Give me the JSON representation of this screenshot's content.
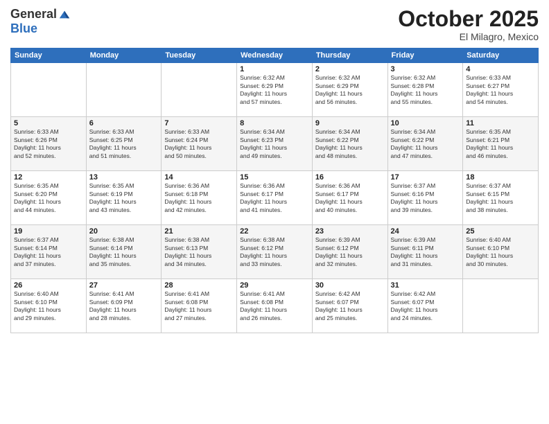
{
  "header": {
    "logo_line1": "General",
    "logo_line2": "Blue",
    "month": "October 2025",
    "location": "El Milagro, Mexico"
  },
  "days_of_week": [
    "Sunday",
    "Monday",
    "Tuesday",
    "Wednesday",
    "Thursday",
    "Friday",
    "Saturday"
  ],
  "weeks": [
    [
      {
        "day": "",
        "info": ""
      },
      {
        "day": "",
        "info": ""
      },
      {
        "day": "",
        "info": ""
      },
      {
        "day": "1",
        "info": "Sunrise: 6:32 AM\nSunset: 6:29 PM\nDaylight: 11 hours\nand 57 minutes."
      },
      {
        "day": "2",
        "info": "Sunrise: 6:32 AM\nSunset: 6:29 PM\nDaylight: 11 hours\nand 56 minutes."
      },
      {
        "day": "3",
        "info": "Sunrise: 6:32 AM\nSunset: 6:28 PM\nDaylight: 11 hours\nand 55 minutes."
      },
      {
        "day": "4",
        "info": "Sunrise: 6:33 AM\nSunset: 6:27 PM\nDaylight: 11 hours\nand 54 minutes."
      }
    ],
    [
      {
        "day": "5",
        "info": "Sunrise: 6:33 AM\nSunset: 6:26 PM\nDaylight: 11 hours\nand 52 minutes."
      },
      {
        "day": "6",
        "info": "Sunrise: 6:33 AM\nSunset: 6:25 PM\nDaylight: 11 hours\nand 51 minutes."
      },
      {
        "day": "7",
        "info": "Sunrise: 6:33 AM\nSunset: 6:24 PM\nDaylight: 11 hours\nand 50 minutes."
      },
      {
        "day": "8",
        "info": "Sunrise: 6:34 AM\nSunset: 6:23 PM\nDaylight: 11 hours\nand 49 minutes."
      },
      {
        "day": "9",
        "info": "Sunrise: 6:34 AM\nSunset: 6:22 PM\nDaylight: 11 hours\nand 48 minutes."
      },
      {
        "day": "10",
        "info": "Sunrise: 6:34 AM\nSunset: 6:22 PM\nDaylight: 11 hours\nand 47 minutes."
      },
      {
        "day": "11",
        "info": "Sunrise: 6:35 AM\nSunset: 6:21 PM\nDaylight: 11 hours\nand 46 minutes."
      }
    ],
    [
      {
        "day": "12",
        "info": "Sunrise: 6:35 AM\nSunset: 6:20 PM\nDaylight: 11 hours\nand 44 minutes."
      },
      {
        "day": "13",
        "info": "Sunrise: 6:35 AM\nSunset: 6:19 PM\nDaylight: 11 hours\nand 43 minutes."
      },
      {
        "day": "14",
        "info": "Sunrise: 6:36 AM\nSunset: 6:18 PM\nDaylight: 11 hours\nand 42 minutes."
      },
      {
        "day": "15",
        "info": "Sunrise: 6:36 AM\nSunset: 6:17 PM\nDaylight: 11 hours\nand 41 minutes."
      },
      {
        "day": "16",
        "info": "Sunrise: 6:36 AM\nSunset: 6:17 PM\nDaylight: 11 hours\nand 40 minutes."
      },
      {
        "day": "17",
        "info": "Sunrise: 6:37 AM\nSunset: 6:16 PM\nDaylight: 11 hours\nand 39 minutes."
      },
      {
        "day": "18",
        "info": "Sunrise: 6:37 AM\nSunset: 6:15 PM\nDaylight: 11 hours\nand 38 minutes."
      }
    ],
    [
      {
        "day": "19",
        "info": "Sunrise: 6:37 AM\nSunset: 6:14 PM\nDaylight: 11 hours\nand 37 minutes."
      },
      {
        "day": "20",
        "info": "Sunrise: 6:38 AM\nSunset: 6:14 PM\nDaylight: 11 hours\nand 35 minutes."
      },
      {
        "day": "21",
        "info": "Sunrise: 6:38 AM\nSunset: 6:13 PM\nDaylight: 11 hours\nand 34 minutes."
      },
      {
        "day": "22",
        "info": "Sunrise: 6:38 AM\nSunset: 6:12 PM\nDaylight: 11 hours\nand 33 minutes."
      },
      {
        "day": "23",
        "info": "Sunrise: 6:39 AM\nSunset: 6:12 PM\nDaylight: 11 hours\nand 32 minutes."
      },
      {
        "day": "24",
        "info": "Sunrise: 6:39 AM\nSunset: 6:11 PM\nDaylight: 11 hours\nand 31 minutes."
      },
      {
        "day": "25",
        "info": "Sunrise: 6:40 AM\nSunset: 6:10 PM\nDaylight: 11 hours\nand 30 minutes."
      }
    ],
    [
      {
        "day": "26",
        "info": "Sunrise: 6:40 AM\nSunset: 6:10 PM\nDaylight: 11 hours\nand 29 minutes."
      },
      {
        "day": "27",
        "info": "Sunrise: 6:41 AM\nSunset: 6:09 PM\nDaylight: 11 hours\nand 28 minutes."
      },
      {
        "day": "28",
        "info": "Sunrise: 6:41 AM\nSunset: 6:08 PM\nDaylight: 11 hours\nand 27 minutes."
      },
      {
        "day": "29",
        "info": "Sunrise: 6:41 AM\nSunset: 6:08 PM\nDaylight: 11 hours\nand 26 minutes."
      },
      {
        "day": "30",
        "info": "Sunrise: 6:42 AM\nSunset: 6:07 PM\nDaylight: 11 hours\nand 25 minutes."
      },
      {
        "day": "31",
        "info": "Sunrise: 6:42 AM\nSunset: 6:07 PM\nDaylight: 11 hours\nand 24 minutes."
      },
      {
        "day": "",
        "info": ""
      }
    ]
  ]
}
